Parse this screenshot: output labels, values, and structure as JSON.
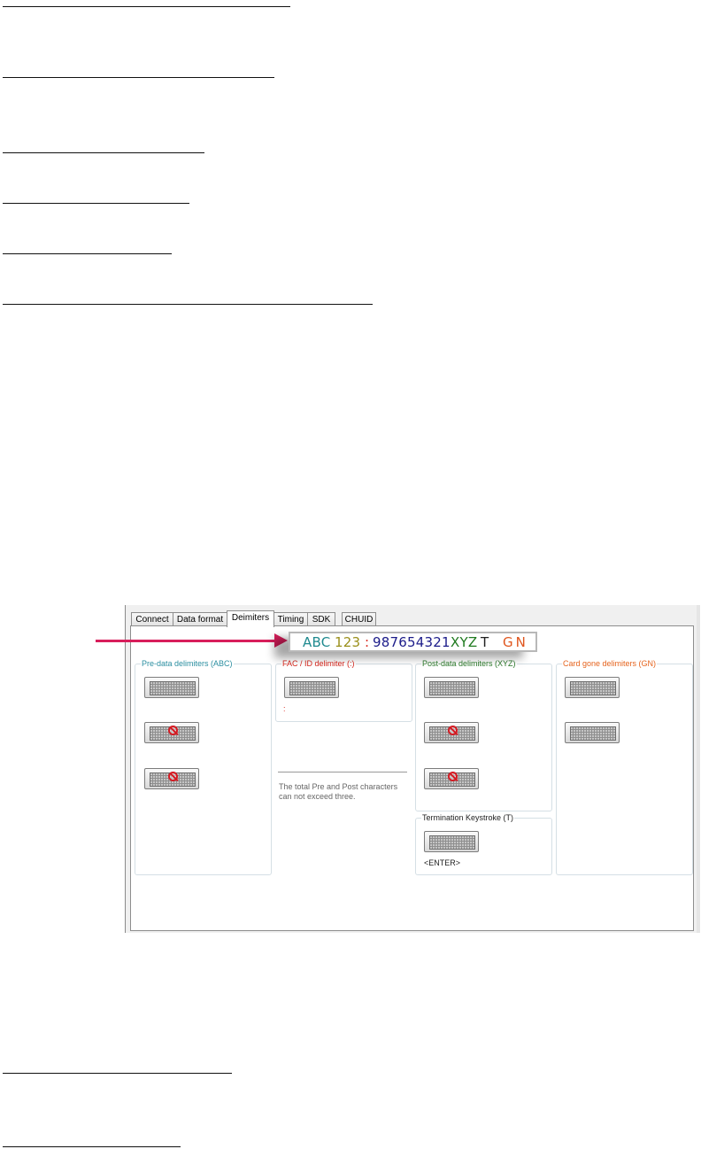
{
  "tabs": [
    "Connect",
    "Data format",
    "Deimiters",
    "Timing",
    "SDK",
    "CHUID"
  ],
  "active_tab": "Deimiters",
  "sample": {
    "abc": "ABC",
    "num123": "123",
    "colon": ":",
    "digits": "987654321",
    "xyz": "XYZ",
    "t": "T",
    "gn": "GN"
  },
  "groups": {
    "pre": "Pre-data delimiters (ABC)",
    "fac": "FAC / ID delimiter (:)",
    "post": "Post-data delimiters (XYZ)",
    "gone": "Card gone delimiters (GN)",
    "term": "Termination Keystroke (T)"
  },
  "fac_value": ":",
  "term_value": "<ENTER>",
  "note_line1": "The total Pre and Post characters",
  "note_line2": "can not exceed three.",
  "colors": {
    "pre": "#2a8ea0",
    "fac": "#d8261c",
    "post": "#2a7a2a",
    "gone": "#e5641e",
    "abc": "#208a8f",
    "num123": "#9a8f1a",
    "digits": "#1c1c8a",
    "xyz": "#1f7a1f",
    "t": "#222222",
    "gn": "#e0561e",
    "arrow": "#d81e5b"
  },
  "icons": {
    "keyboard": "keyboard-icon",
    "disabled": "no-symbol-icon"
  }
}
